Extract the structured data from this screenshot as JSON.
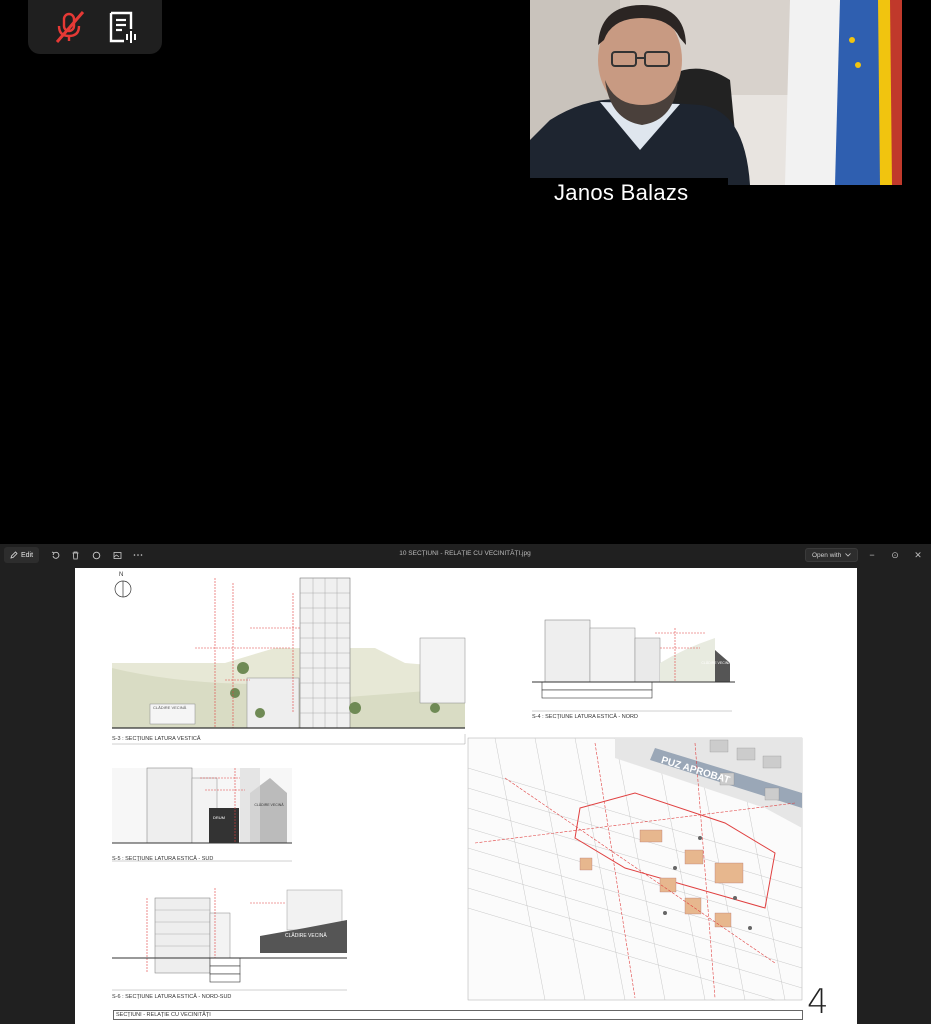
{
  "meeting": {
    "participant_name": "Janos Balazs",
    "controls": [
      {
        "name": "mic-muted-icon",
        "color": "#e53935"
      },
      {
        "name": "transcript-icon",
        "color": "#ffffff"
      }
    ]
  },
  "viewer": {
    "edit_label": "Edit",
    "file_name": "10 SECȚIUNI - RELAȚIE CU VECINITĂȚI.jpg",
    "open_with_label": "Open with",
    "toolbar_icons": [
      "rotate-icon",
      "delete-icon",
      "favorite-icon",
      "edit-image-icon",
      "more-icon"
    ],
    "window_buttons": {
      "minimize": "−",
      "maximize": "⊙",
      "close": "✕"
    }
  },
  "drawing": {
    "north": "N",
    "s3_caption": "S-3 : SECȚIUNE LATURA VESTICĂ",
    "s4_caption": "S-4 : SECȚIUNE LATURA ESTICĂ - NORD",
    "s5_caption": "S-5 : SECȚIUNE LATURA ESTICĂ - SUD",
    "s6_caption": "S-6 : SECȚIUNE LATURA ESTICĂ - NORD-SUD",
    "cladire_vecina": "CLĂDIRE VECINĂ",
    "drum": "DRUM",
    "puz_aprobat": "PUZ APROBAT",
    "page_number": "4",
    "sheet_title": "SECȚIUNI - RELAȚIE CU VECINITĂȚI"
  }
}
